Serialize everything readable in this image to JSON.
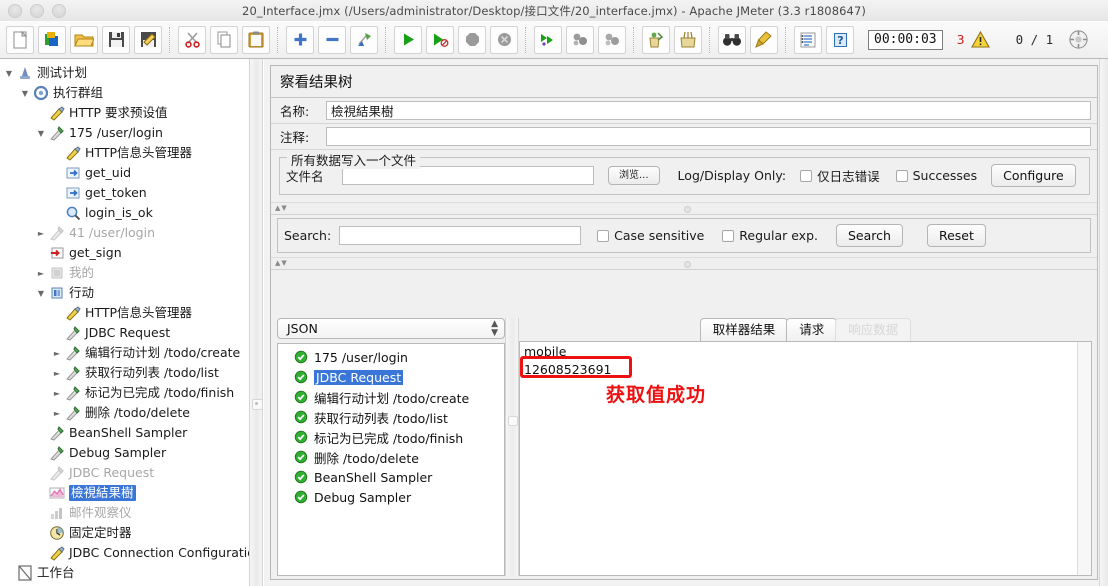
{
  "window": {
    "title": "20_Interface.jmx (/Users/administrator/Desktop/接口文件/20_interface.jmx) - Apache JMeter (3.3 r1808647)"
  },
  "toolbar": {
    "buttons": [
      {
        "name": "new-icon",
        "glyph": "new"
      },
      {
        "name": "templates-icon",
        "glyph": "templates"
      },
      {
        "name": "open-icon",
        "glyph": "open"
      },
      {
        "name": "save-icon",
        "glyph": "save"
      },
      {
        "name": "save-as-icon",
        "glyph": "saveas"
      },
      {
        "name": "cut-icon",
        "glyph": "cut"
      },
      {
        "name": "copy-icon",
        "glyph": "copy"
      },
      {
        "name": "paste-icon",
        "glyph": "paste"
      },
      {
        "name": "expand-all-icon",
        "glyph": "plus"
      },
      {
        "name": "collapse-all-icon",
        "glyph": "minus"
      },
      {
        "name": "toggle-icon",
        "glyph": "toggle"
      },
      {
        "name": "start-icon",
        "glyph": "start"
      },
      {
        "name": "start-no-pauses-icon",
        "glyph": "startnp"
      },
      {
        "name": "stop-icon",
        "glyph": "stop"
      },
      {
        "name": "shutdown-icon",
        "glyph": "shutdown"
      },
      {
        "name": "remote-start-all-icon",
        "glyph": "rstartall"
      },
      {
        "name": "remote-stop-all-icon",
        "glyph": "rstopall"
      },
      {
        "name": "remote-shutdown-all-icon",
        "glyph": "rshutall"
      },
      {
        "name": "clear-icon",
        "glyph": "clear"
      },
      {
        "name": "clear-all-icon",
        "glyph": "clearall"
      },
      {
        "name": "search-icon",
        "glyph": "binocular"
      },
      {
        "name": "reset-search-icon",
        "glyph": "broom"
      },
      {
        "name": "function-helper-icon",
        "glyph": "funchelper"
      },
      {
        "name": "help-icon",
        "glyph": "help"
      }
    ],
    "timer": "00:00:03",
    "warning_count": "3",
    "run_count": "0 / 1"
  },
  "tree": {
    "items": [
      {
        "depth": 0,
        "twisty": "down",
        "icon": "test-plan-icon",
        "label": "测试计划",
        "state": "normal"
      },
      {
        "depth": 1,
        "twisty": "down",
        "icon": "thread-group-icon",
        "label": "执行群组",
        "state": "normal"
      },
      {
        "depth": 2,
        "twisty": "none",
        "icon": "config-element-icon",
        "label": "HTTP 要求预设值",
        "state": "normal"
      },
      {
        "depth": 2,
        "twisty": "down",
        "icon": "sampler-icon",
        "label": "175  /user/login",
        "state": "normal"
      },
      {
        "depth": 3,
        "twisty": "none",
        "icon": "config-element-icon",
        "label": "HTTP信息头管理器",
        "state": "normal"
      },
      {
        "depth": 3,
        "twisty": "none",
        "icon": "post-processor-icon",
        "label": "get_uid",
        "state": "normal"
      },
      {
        "depth": 3,
        "twisty": "none",
        "icon": "post-processor-icon",
        "label": "get_token",
        "state": "normal"
      },
      {
        "depth": 3,
        "twisty": "none",
        "icon": "assertion-icon",
        "label": "login_is_ok",
        "state": "normal"
      },
      {
        "depth": 2,
        "twisty": "right",
        "icon": "sampler-disabled-icon",
        "label": "41  /user/login",
        "state": "disabled"
      },
      {
        "depth": 2,
        "twisty": "none",
        "icon": "pre-processor-icon",
        "label": "get_sign",
        "state": "normal"
      },
      {
        "depth": 2,
        "twisty": "right",
        "icon": "controller-disabled-icon",
        "label": "我的",
        "state": "disabled"
      },
      {
        "depth": 2,
        "twisty": "down",
        "icon": "controller-icon",
        "label": "行动",
        "state": "normal"
      },
      {
        "depth": 3,
        "twisty": "none",
        "icon": "config-element-icon",
        "label": "HTTP信息头管理器",
        "state": "normal"
      },
      {
        "depth": 3,
        "twisty": "none",
        "icon": "sampler-icon",
        "label": "JDBC Request",
        "state": "normal"
      },
      {
        "depth": 3,
        "twisty": "right",
        "icon": "sampler-icon",
        "label": "编辑行动计划  /todo/create",
        "state": "normal"
      },
      {
        "depth": 3,
        "twisty": "right",
        "icon": "sampler-icon",
        "label": "获取行动列表  /todo/list",
        "state": "normal"
      },
      {
        "depth": 3,
        "twisty": "right",
        "icon": "sampler-icon",
        "label": "标记为已完成  /todo/finish",
        "state": "normal"
      },
      {
        "depth": 3,
        "twisty": "right",
        "icon": "sampler-icon",
        "label": "删除  /todo/delete",
        "state": "normal"
      },
      {
        "depth": 2,
        "twisty": "none",
        "icon": "sampler-icon",
        "label": "BeanShell Sampler",
        "state": "normal"
      },
      {
        "depth": 2,
        "twisty": "none",
        "icon": "sampler-icon",
        "label": "Debug Sampler",
        "state": "normal"
      },
      {
        "depth": 2,
        "twisty": "none",
        "icon": "sampler-disabled-icon",
        "label": "JDBC Request",
        "state": "disabled"
      },
      {
        "depth": 2,
        "twisty": "none",
        "icon": "view-results-tree-icon",
        "label": "檢視結果樹",
        "state": "selected"
      },
      {
        "depth": 2,
        "twisty": "none",
        "icon": "mailer-visualizer-disabled-icon",
        "label": "邮件观察仪",
        "state": "disabled"
      },
      {
        "depth": 2,
        "twisty": "none",
        "icon": "timer-icon",
        "label": "固定定时器",
        "state": "normal"
      },
      {
        "depth": 2,
        "twisty": "none",
        "icon": "config-element-icon",
        "label": "JDBC Connection Configuration",
        "state": "normal"
      },
      {
        "depth": 0,
        "twisty": "none",
        "icon": "workbench-icon",
        "label": "工作台",
        "state": "normal"
      }
    ]
  },
  "panel": {
    "title": "察看结果树",
    "name_label": "名称:",
    "name_value": "檢視結果樹",
    "comment_label": "注释:",
    "comment_value": "",
    "group_legend": "所有数据写入一个文件",
    "filename_label": "文件名",
    "filename_value": "",
    "browse_button": "浏览...",
    "log_display_label": "Log/Display Only:",
    "errors_only_checkbox": "仅日志错误",
    "successes_checkbox": "Successes",
    "configure_button": "Configure",
    "search_label": "Search:",
    "search_value": "",
    "case_sensitive_checkbox": "Case sensitive",
    "regular_exp_checkbox": "Regular exp.",
    "search_button": "Search",
    "reset_button": "Reset"
  },
  "renderer": {
    "selected": "JSON"
  },
  "results": {
    "items": [
      {
        "label": "175  /user/login",
        "selected": false
      },
      {
        "label": "JDBC Request",
        "selected": true
      },
      {
        "label": "编辑行动计划  /todo/create",
        "selected": false
      },
      {
        "label": "获取行动列表  /todo/list",
        "selected": false
      },
      {
        "label": "标记为已完成  /todo/finish",
        "selected": false
      },
      {
        "label": "删除  /todo/delete",
        "selected": false
      },
      {
        "label": "BeanShell Sampler",
        "selected": false
      },
      {
        "label": "Debug Sampler",
        "selected": false
      }
    ]
  },
  "detail": {
    "tabs": [
      {
        "label": "取样器结果",
        "state": "active"
      },
      {
        "label": "请求",
        "state": "normal"
      },
      {
        "label": "响应数据",
        "state": "disabled"
      }
    ],
    "line1": "mobile",
    "line2": "12608523691",
    "annotation": "获取值成功",
    "annotation_color": "#ee1111"
  }
}
